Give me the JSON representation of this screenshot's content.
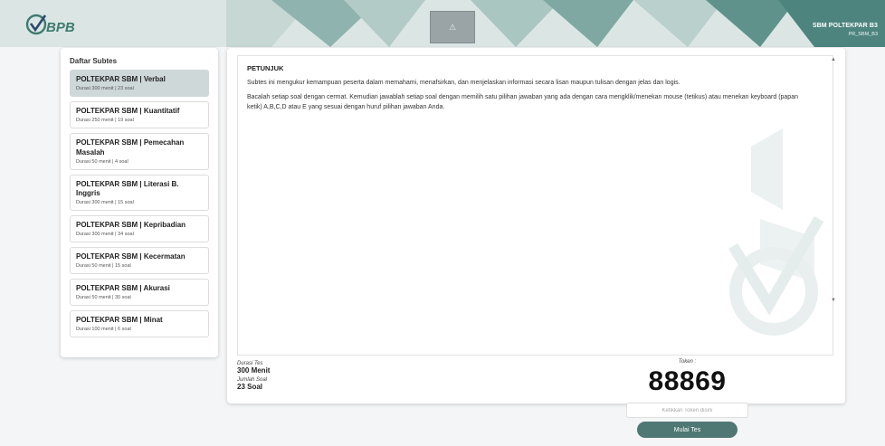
{
  "header": {
    "logo_text": "BPB",
    "center_tab_icon": "warning-icon",
    "center_tab_glyph": "⚠",
    "user_name": "SBM POLTEKPAR B3",
    "user_id": "PR_SBM_B3"
  },
  "sidebar": {
    "title": "Daftar Subtes",
    "items": [
      {
        "name": "POLTEKPAR SBM | Verbal",
        "meta": "Durasi 300 menit  |  23 soal",
        "active": true
      },
      {
        "name": "POLTEKPAR SBM | Kuantitatif",
        "meta": "Durasi 250 menit  |  19 soal",
        "active": false
      },
      {
        "name": "POLTEKPAR SBM | Pemecahan Masalah",
        "meta": "Durasi 50 menit  |  4 soal",
        "active": false
      },
      {
        "name": "POLTEKPAR SBM | Literasi B. Inggris",
        "meta": "Durasi 300 menit  |  15 soal",
        "active": false
      },
      {
        "name": "POLTEKPAR SBM | Kepribadian",
        "meta": "Durasi 300 menit  |  34 soal",
        "active": false
      },
      {
        "name": "POLTEKPAR SBM | Kecermatan",
        "meta": "Durasi 50 menit  |  15 soal",
        "active": false
      },
      {
        "name": "POLTEKPAR SBM | Akurasi",
        "meta": "Durasi 50 menit  |  30 soal",
        "active": false
      },
      {
        "name": "POLTEKPAR SBM | Minat",
        "meta": "Durasi 100 menit  |  6 soal",
        "active": false
      }
    ]
  },
  "main": {
    "instructions_title": "PETUNJUK",
    "instructions_p1": "Subtes ini mengukur kemampuan peserta dalam memahami, menafsirkan, dan menjelaskan informasi secara lisan maupun tulisan dengan jelas dan logis.",
    "instructions_p2": "Bacalah setiap soal dengan cermat. Kemudian jawablah setiap soal dengan memilih satu pilihan jawaban yang ada dengan cara mengklik/menekan mouse (tetikus) atau menekan keyboard (papan ketik) A,B,C,D atau E yang sesuai dengan huruf pilihan jawaban Anda.",
    "duration_label": "Durasi Tes",
    "duration_value": "300 Menit",
    "count_label": "Jumlah Soal",
    "count_value": "23 Soal",
    "token_label": "Token :",
    "token_value": "88869",
    "token_placeholder": "Ketikkan Token disini",
    "start_label": "Mulai Tes"
  },
  "colors": {
    "accent": "#4f7773",
    "header_bg": "#dbe6e4",
    "active_item": "#cfd8d9",
    "logo_green": "#3e7a6e",
    "logo_blue": "#2a4a6e"
  }
}
